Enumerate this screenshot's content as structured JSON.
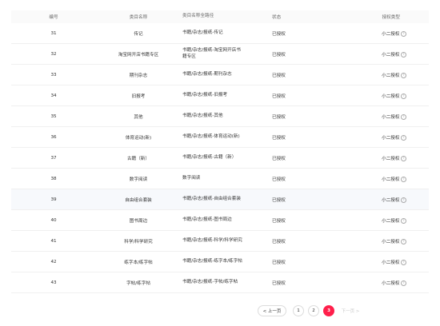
{
  "table": {
    "headers": {
      "no": "编号",
      "name": "类目名称",
      "path": "类目名称全路径",
      "status": "状态",
      "auth": "授权类型"
    },
    "rows": [
      {
        "no": "31",
        "name": "传记",
        "path": "书籍/杂志/报纸-传记",
        "status": "已授权",
        "auth": "小二授权"
      },
      {
        "no": "32",
        "name": "淘宝网开店书籍专区",
        "path": "书籍/杂志/报纸-淘宝网开店书籍专区",
        "status": "已授权",
        "auth": "小二授权"
      },
      {
        "no": "33",
        "name": "期刊杂志",
        "path": "书籍/杂志/报纸-期刊杂志",
        "status": "已授权",
        "auth": "小二授权"
      },
      {
        "no": "34",
        "name": "旧报考",
        "path": "书籍/杂志/报纸-旧报考",
        "status": "已授权",
        "auth": "小二授权"
      },
      {
        "no": "35",
        "name": "其他",
        "path": "书籍/杂志/报纸-其他",
        "status": "已授权",
        "auth": "小二授权"
      },
      {
        "no": "36",
        "name": "体育运动(新)",
        "path": "书籍/杂志/报纸-体育运动(新)",
        "status": "已授权",
        "auth": "小二授权"
      },
      {
        "no": "37",
        "name": "古籍（新）",
        "path": "书籍/杂志/报纸-古籍（新）",
        "status": "已授权",
        "auth": "小二授权"
      },
      {
        "no": "38",
        "name": "数字阅读",
        "path": "数字阅读",
        "status": "已授权",
        "auth": "小二授权"
      },
      {
        "no": "39",
        "name": "自由组合套装",
        "path": "书籍/杂志/报纸-自由组合套装",
        "status": "已授权",
        "auth": "小二授权"
      },
      {
        "no": "40",
        "name": "图书周边",
        "path": "书籍/杂志/报纸-图书周边",
        "status": "已授权",
        "auth": "小二授权"
      },
      {
        "no": "41",
        "name": "科学/科学研究",
        "path": "书籍/杂志/报纸-科学/科学研究",
        "status": "已授权",
        "auth": "小二授权"
      },
      {
        "no": "42",
        "name": "练字本/练字帖",
        "path": "书籍/杂志/报纸-练字本/练字帖",
        "status": "已授权",
        "auth": "小二授权"
      },
      {
        "no": "43",
        "name": "字帖/练字帖",
        "path": "书籍/杂志/报纸-字帖/练字帖",
        "status": "已授权",
        "auth": "小二授权"
      }
    ]
  },
  "pagination": {
    "prev_label": "< 上一页",
    "pages": [
      "1",
      "2",
      "3"
    ],
    "current": "3",
    "next_label": "下一页 >"
  },
  "icons": {
    "help": "question-circle-icon"
  },
  "colors": {
    "accent": "#ff1f4b",
    "header_bg": "#fafafa",
    "highlight_row": "#f7f9fc"
  }
}
